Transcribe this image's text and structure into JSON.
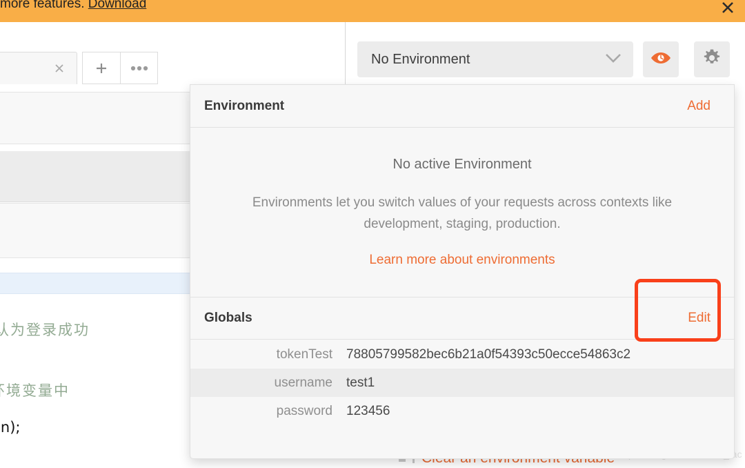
{
  "banner": {
    "text": "more features.",
    "link_label": "Download",
    "close_icon": "close-icon",
    "bg_color": "#F9AE47"
  },
  "tabstrip": {
    "close_icon": "close-icon",
    "add_label": "+",
    "more_label": "•••"
  },
  "env_header": {
    "selected_environment": "No Environment",
    "chevron_icon": "chevron-down-icon",
    "eye_icon": "eye-icon",
    "gear_icon": "gear-icon",
    "eye_color": "#EE6C33"
  },
  "env_panel": {
    "header": {
      "title": "Environment",
      "add_label": "Add"
    },
    "empty_state": {
      "title": "No active Environment",
      "description": "Environments let you switch values of your requests across contexts like development, staging, production.",
      "learn_more_label": "Learn more about environments"
    },
    "globals": {
      "title": "Globals",
      "edit_label": "Edit",
      "variables": [
        {
          "key": "tokenTest",
          "value": "78805799582bec6b21a0f54393c50ecce54863c2"
        },
        {
          "key": "username",
          "value": "test1"
        },
        {
          "key": "password",
          "value": "123456"
        }
      ]
    }
  },
  "editor_background": {
    "lines": [
      {
        "text": "认为登录成功",
        "kind": "comment"
      },
      {
        "text": "环境变量中",
        "kind": "comment"
      },
      {
        "text": "en);",
        "kind": "plain"
      }
    ]
  },
  "snippet": {
    "label": "Clear an environment variable"
  },
  "watermark": {
    "text": "https://blog.csdn.net/cai_iac"
  },
  "annotation": {
    "color": "#F9401A",
    "target": "Edit"
  }
}
